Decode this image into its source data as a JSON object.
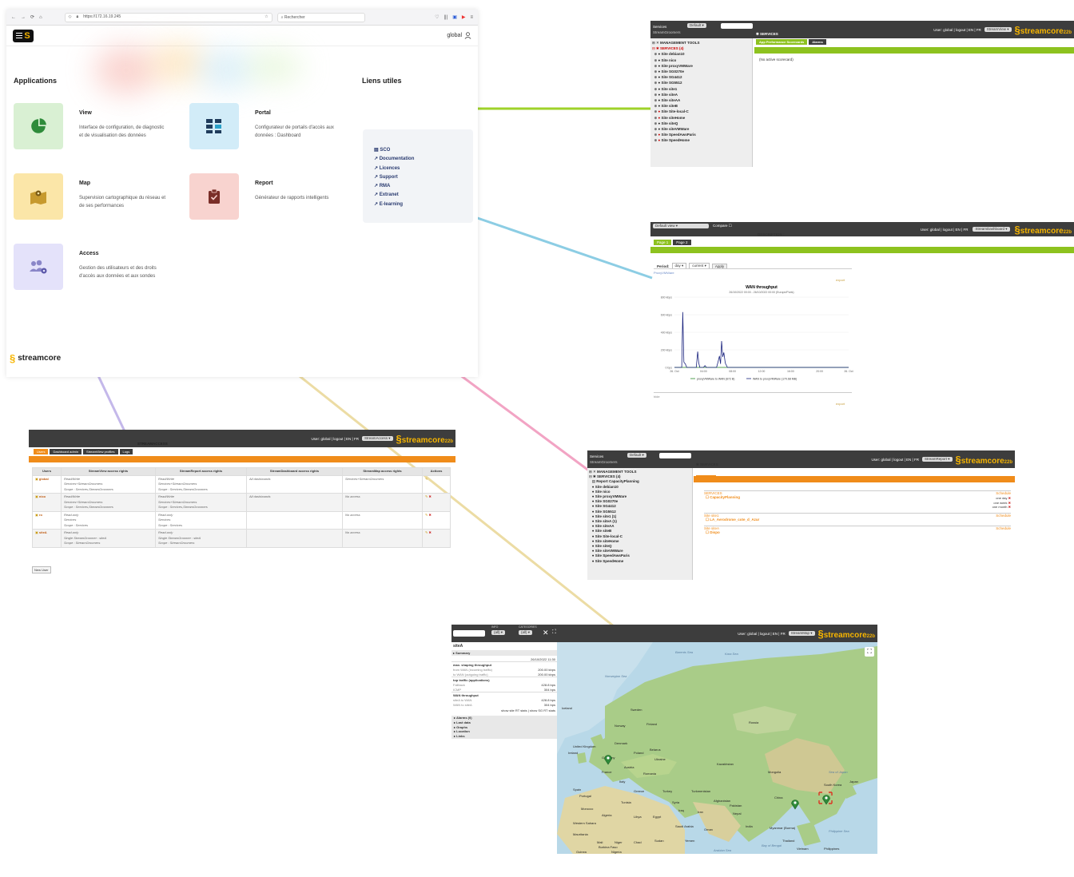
{
  "browser": {
    "url": "https://172.16.19.245",
    "search_placeholder": "Rechercher",
    "user_label": "global"
  },
  "portal": {
    "applications_title": "Applications",
    "links_title": "Liens utiles",
    "apps": [
      {
        "name": "View",
        "desc": "Interface de configuration, de diagnostic et de visualisation des données"
      },
      {
        "name": "Portal",
        "desc": "Configurateur de portails d'accès aux données : Dashboard"
      },
      {
        "name": "Map",
        "desc": "Supervision cartographique du réseau et de ses performances"
      },
      {
        "name": "Report",
        "desc": "Générateur de rapports intelligents"
      },
      {
        "name": "Access",
        "desc": "Gestion des utilisateurs et des droits d'accès aux données et aux sondes"
      }
    ],
    "links": [
      "SCO",
      "Documentation",
      "Licences",
      "Support",
      "RMA",
      "Extranet",
      "E-learning"
    ],
    "brand": "streamcore"
  },
  "view_app": {
    "services_label": "Services",
    "default_label": "Default",
    "user_bar": "User: global | logout | EN | FR",
    "app_select": "StreamView",
    "logo": "streamcore",
    "logo_sub": "22b",
    "groomers": "StreamGroomers",
    "services_header": "SERVICES",
    "tabs": [
      "App Performance Scorecards",
      "Alarms"
    ],
    "empty": "(No active scorecard)",
    "tree": [
      "MANAGEMENT TOOLS",
      "SERVICES (4)",
      "Site debian10",
      "Site nico",
      "Site proxyVMWare",
      "Site SG0270e",
      "Site SG4412",
      "Site SG5512",
      "Site site1",
      "Site siteA",
      "Site siteAA",
      "Site siteB",
      "Site Site-local-C",
      "Site siteHome",
      "Site siteQ",
      "Site siteVMWare",
      "Site SpeedAwsParis",
      "Site SpeedHome"
    ]
  },
  "dashboard_app": {
    "default_view": "Default view",
    "compare": "Compare",
    "user_bar": "User: global | logout | EN | FR",
    "app_select": "StreamDashboard",
    "logo": "streamcore",
    "logo_sub": "22b",
    "description": "DESCRIPTION :",
    "pages": [
      "Page 1",
      "Page 2"
    ],
    "period_label": "Period:",
    "period_value": "day",
    "current": "current",
    "apply": "Apply",
    "proxy_label": "ProxyVMWare",
    "export": "export",
    "chart_title": "WAN throughput",
    "chart_subtitle": "26/10/2022 00:00 - 26/10/2022 00:00 (Europe/Paris)",
    "legend": [
      "proxyVMWare to WAN (672 B)",
      "WAN to proxyVMWare (170.68 MB)"
    ],
    "hide": "hide",
    "export2": "export"
  },
  "chart_data": {
    "type": "line",
    "title": "WAN throughput",
    "subtitle": "26/10/2022 00:00 - 26/10/2022 00:00 (Europe/Paris)",
    "xlabel": "",
    "ylabel": "",
    "x": [
      "26. Oct",
      "04:00",
      "08:00",
      "12:00",
      "16:00",
      "20:00",
      "26. Oct"
    ],
    "ytick_labels": [
      "0 bps",
      "200 kbps",
      "400 kbps",
      "600 kbps",
      "800 kbps"
    ],
    "ylim": [
      0,
      800
    ],
    "y_unit": "kbps",
    "series": [
      {
        "name": "proxyVMWare to WAN (672 B)",
        "color": "#2a8a2a",
        "points": [
          [
            0,
            0
          ],
          [
            24,
            0
          ]
        ]
      },
      {
        "name": "WAN to proxyVMWare (170.68 MB)",
        "color": "#1a237e",
        "points": [
          [
            0,
            0
          ],
          [
            1.0,
            0
          ],
          [
            1.15,
            630
          ],
          [
            1.3,
            60
          ],
          [
            1.5,
            40
          ],
          [
            1.7,
            0
          ],
          [
            3.0,
            0
          ],
          [
            3.2,
            180
          ],
          [
            3.35,
            50
          ],
          [
            3.5,
            0
          ],
          [
            4.0,
            0
          ],
          [
            4.2,
            20
          ],
          [
            4.4,
            0
          ],
          [
            5.8,
            0
          ],
          [
            6.0,
            60
          ],
          [
            6.2,
            130
          ],
          [
            6.35,
            40
          ],
          [
            6.5,
            300
          ],
          [
            6.65,
            120
          ],
          [
            6.8,
            170
          ],
          [
            7.0,
            50
          ],
          [
            7.3,
            0
          ],
          [
            24,
            0
          ]
        ]
      }
    ],
    "grid": true,
    "legend_position": "bottom"
  },
  "access_app": {
    "user_bar": "User: global | logout | EN | FR",
    "app_select": "StreamAccess",
    "logo": "streamcore",
    "logo_sub": "22b",
    "title": "STREAMACCESS",
    "tabs": [
      "Users",
      "Dashboard admin",
      "StreamView profiles",
      "Logs"
    ],
    "columns": [
      "Users",
      "StreamView access rights",
      "StreamReport access rights",
      "StreamDashboard access rights",
      "StreamMap access rights",
      "Actions"
    ],
    "rows": [
      {
        "user": "global",
        "view": [
          "Read/Write",
          "Services+StreamGroomers",
          "Scope : Services,StreamGroomers"
        ],
        "report": [
          "Read/Write",
          "Services+StreamGroomers",
          "Scope : Services,StreamGroomers"
        ],
        "dash": "All dashboards",
        "map": "Services+StreamGroomers"
      },
      {
        "user": "nico",
        "view": [
          "Read/Write",
          "Services+StreamGroomers",
          "Scope : Services,StreamGroomers"
        ],
        "report": [
          "Read/Write",
          "Services+StreamGroomers",
          "Scope : Services,StreamGroomers"
        ],
        "dash": "All dashboards",
        "map": "No access"
      },
      {
        "user": "ro",
        "view": [
          "Read-only",
          "Services",
          "Scope : Services"
        ],
        "report": [
          "Read-only",
          "Services",
          "Scope : Services"
        ],
        "dash": "",
        "map": "No access"
      },
      {
        "user": "siteA",
        "view": [
          "Read-only",
          "Single StreamGroomer : siteA",
          "Scope : StreamGroomers"
        ],
        "report": [
          "Read-only",
          "Single StreamGroomer : siteA",
          "Scope : StreamGroomers"
        ],
        "dash": "",
        "map": "No access"
      }
    ],
    "new_user": "New User"
  },
  "report_app": {
    "services_label": "Services",
    "default_label": "Default",
    "user_bar": "User: global | logout | EN | FR",
    "app_select": "StreamReport",
    "logo": "streamcore",
    "logo_sub": "22b",
    "groomers": "StreamGroomers",
    "services_header": "SERVICES",
    "tab": "Summary",
    "tree": [
      "MANAGEMENT TOOLS",
      "SERVICES (4)",
      "Report CapacityPlanning",
      "Site debian10",
      "Site nico",
      "Site proxyVMWare",
      "Site SG0270e",
      "Site SG4412",
      "Site SG5512",
      "Site site1 (1)",
      "Site siteA (1)",
      "Site siteAA",
      "Site siteB",
      "Site Site-local-C",
      "Site siteHome",
      "Site siteQ",
      "Site siteVMWare",
      "Site SpeedAwsParis",
      "Site SpeedHome"
    ],
    "groups": [
      {
        "name": "SERVICES",
        "schedule": "Schedule",
        "items": [
          "CapacityPlanning"
        ]
      },
      {
        "name": "Site site1",
        "schedule": "Schedule",
        "items": [
          "LA_Aerodrome_cote_d_Azur"
        ]
      },
      {
        "name": "Site siteA",
        "schedule": "Schedule",
        "items": [
          "Dispo"
        ]
      }
    ],
    "periods": [
      "one day",
      "one week",
      "one month"
    ]
  },
  "map_app": {
    "info_label": "INFO",
    "info_value": "(all)",
    "category_label": "CATEGORIES",
    "category_value": "(all)",
    "user_bar": "User: global | logout | EN | FR",
    "app_select": "StreamMap",
    "logo": "streamcore",
    "logo_sub": "22b",
    "site": "siteA",
    "summary": "Summary",
    "date": "26/10/2022 11:30",
    "sections": [
      {
        "title": "max. shaping throughput",
        "rows": [
          [
            "from WAN (incoming traffic)",
            "200.00 kbps"
          ],
          [
            "to WAN (outgoing traffic)",
            "200.00 kbps"
          ]
        ]
      },
      {
        "title": "top traffic (applications)",
        "rows": [
          [
            "Fallback",
            "428.8 bps"
          ],
          [
            "ICMP",
            "304 bps"
          ]
        ]
      },
      {
        "title": "WAN throughput",
        "rows": [
          [
            "siteA to WAN",
            "428.8 bps"
          ],
          [
            "WAN to siteA",
            "304 bps"
          ]
        ]
      }
    ],
    "stats_link": "show site RT stats | show SG RT stats",
    "collapsed": [
      "Alarms (0)",
      "Last data",
      "Graphs",
      "Location",
      "Links"
    ],
    "places": [
      "Barents Sea",
      "Kara Sea",
      "Norwegian Sea",
      "Iceland",
      "Sweden",
      "Finland",
      "Norway",
      "Russia",
      "United Kingdom",
      "Denmark",
      "Ireland",
      "Germany",
      "Poland",
      "Belarus",
      "Ukraine",
      "France",
      "Austria",
      "Romania",
      "Italy",
      "Kazakhstan",
      "Mongolia",
      "Spain",
      "Portugal",
      "Greece",
      "Turkey",
      "Turkmenistan",
      "Tunisia",
      "Syria",
      "Iraq",
      "Iran",
      "Afghanistan",
      "Pakistan",
      "Morocco",
      "Algeria",
      "Libya",
      "Egypt",
      "Saudi Arabia",
      "Oman",
      "India",
      "Nepal",
      "China",
      "South Korea",
      "Japan",
      "Western Sahara",
      "Mauritania",
      "Mali",
      "Niger",
      "Chad",
      "Sudan",
      "Yemen",
      "Myanmar (Burma)",
      "Thailand",
      "Vietnam",
      "Philippines",
      "Burkina Faso",
      "Guinea",
      "Nigeria",
      "Sea of Japan",
      "Arabian Sea",
      "Bay of Bengal",
      "Philippine Sea"
    ]
  }
}
